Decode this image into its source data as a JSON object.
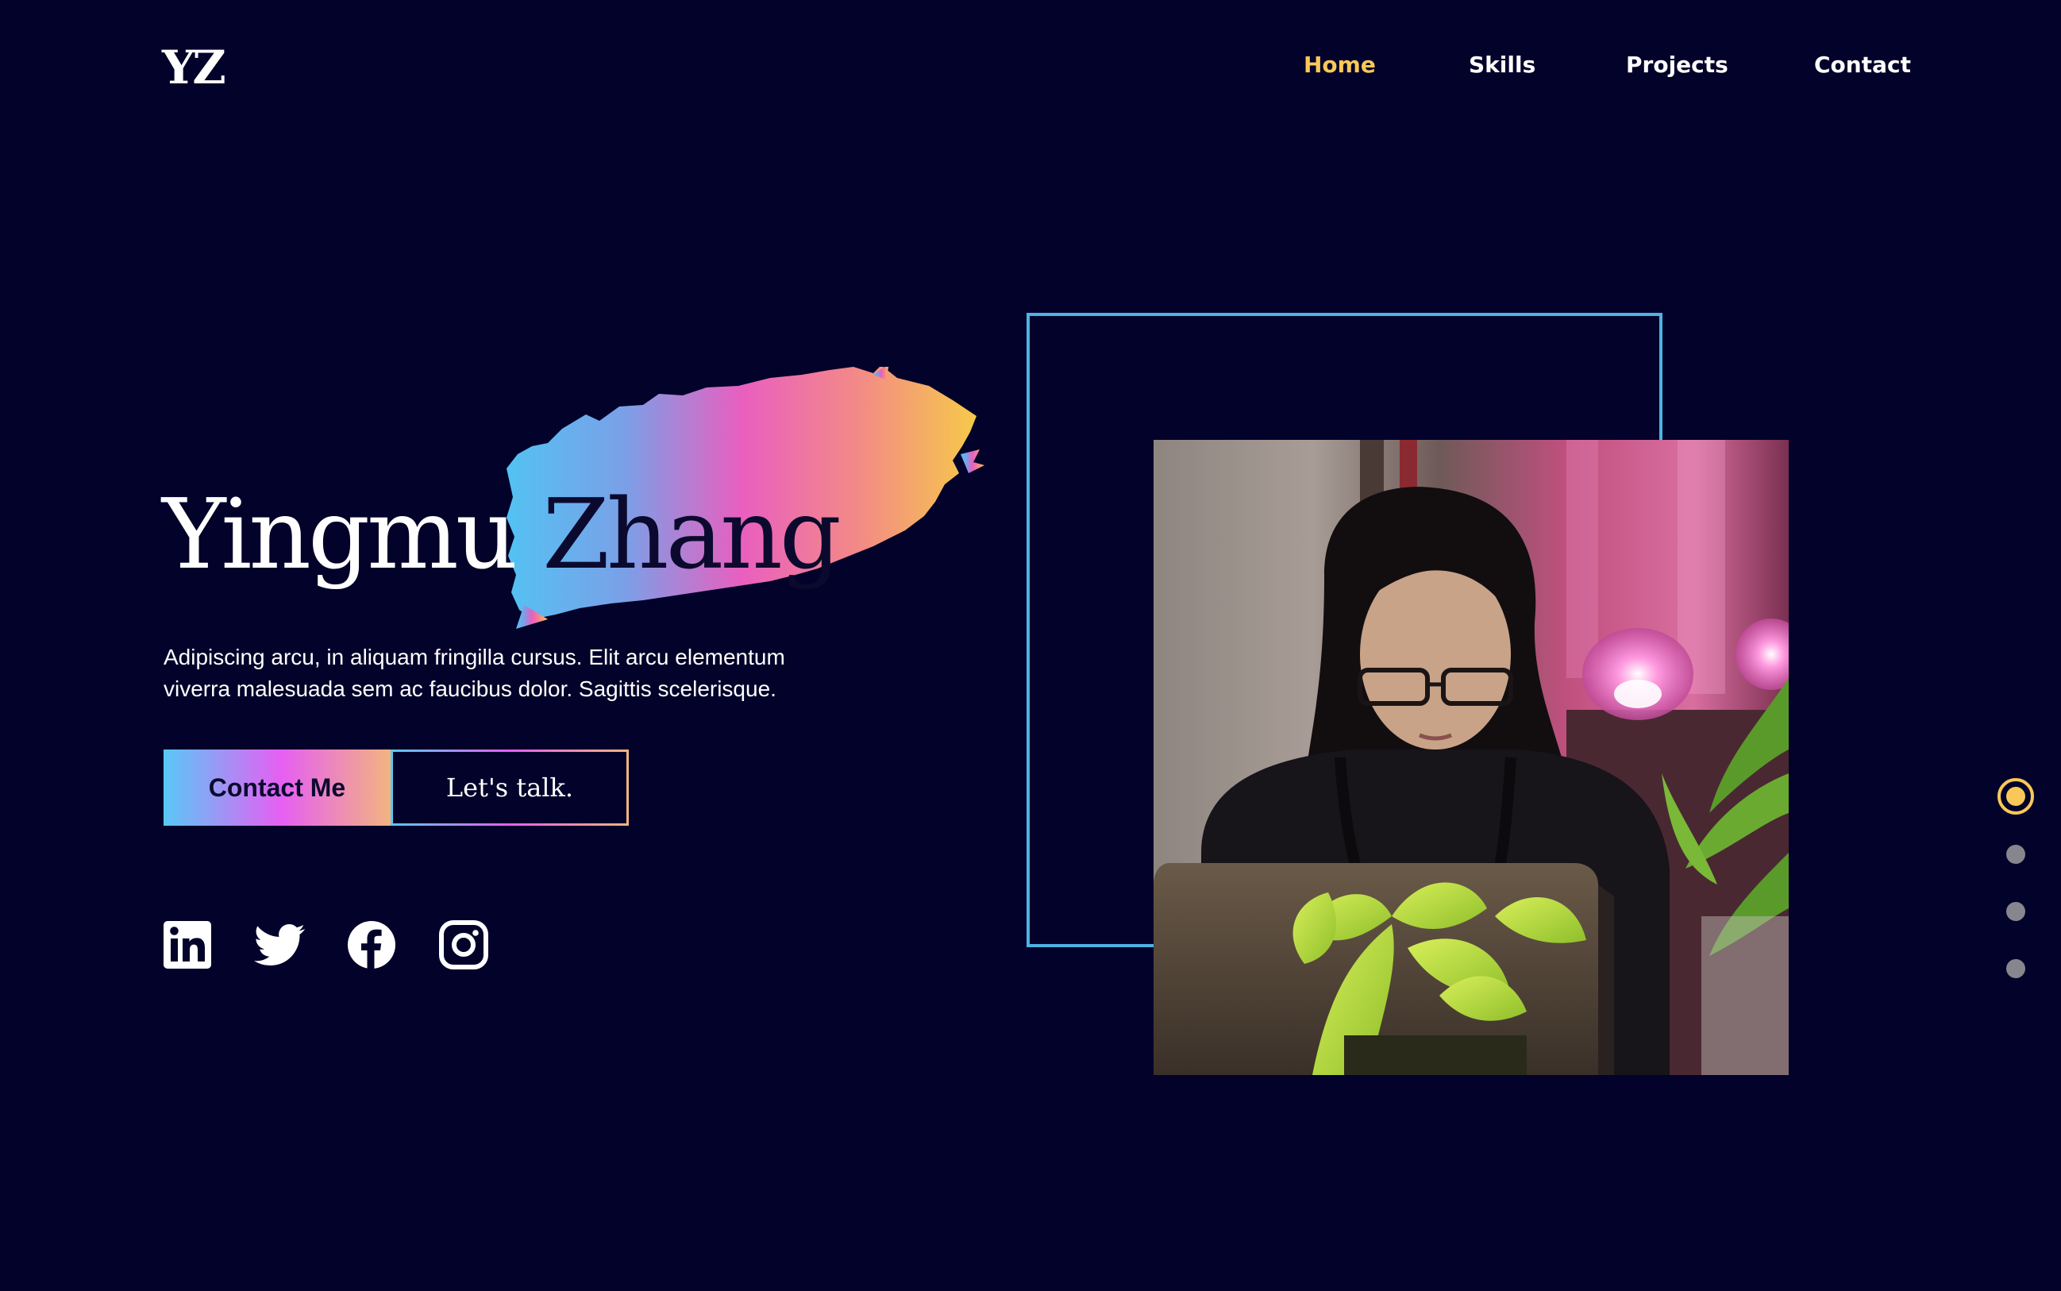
{
  "logo": "YZ",
  "nav": {
    "items": [
      {
        "label": "Home",
        "active": true
      },
      {
        "label": "Skills",
        "active": false
      },
      {
        "label": "Projects",
        "active": false
      },
      {
        "label": "Contact",
        "active": false
      }
    ]
  },
  "hero": {
    "first_name": "Yingmu",
    "last_name": "Zhang",
    "description_line1": "Adipiscing arcu, in aliquam fringilla cursus. Elit arcu elementum",
    "description_line2": "viverra malesuada sem ac faucibus dolor. Sagittis scelerisque.",
    "primary_button": "Contact Me",
    "secondary_button": "Let's talk."
  },
  "social": [
    {
      "name": "linkedin-icon"
    },
    {
      "name": "twitter-icon"
    },
    {
      "name": "facebook-icon"
    },
    {
      "name": "instagram-icon"
    }
  ],
  "page_indicator": {
    "total": 4,
    "active": 1
  },
  "colors": {
    "background": "#03022a",
    "accent": "#f9c858",
    "frame": "#4fb3e3",
    "gradient": [
      "#59c8f7",
      "#e65ff2",
      "#f3b480"
    ]
  }
}
